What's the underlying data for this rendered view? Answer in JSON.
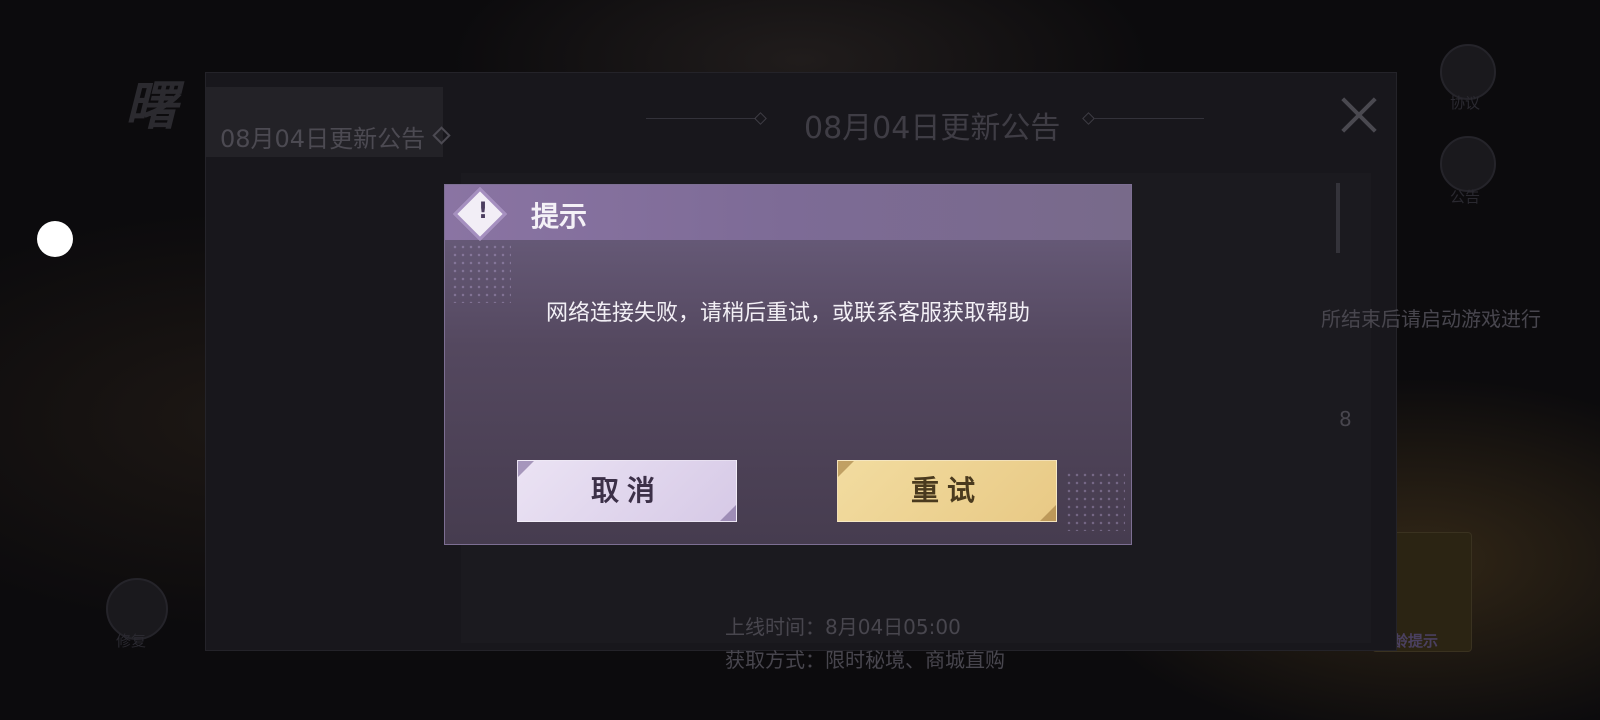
{
  "background": {
    "logo_text": "曙",
    "side_labels": {
      "agreement": "协议",
      "notice": "公告",
      "repair": "修复",
      "age": "适龄提示"
    }
  },
  "panel": {
    "tab_label": "08月04日更新公告",
    "title": "08月04日更新公告",
    "content_lines": {
      "line1": "所结束后请启动游戏进行",
      "line2": "8",
      "line3": "上线时间：8月04日05:00",
      "line4": "获取方式：限时秘境、商城直购"
    }
  },
  "dialog": {
    "title": "提示",
    "emblem_glyph": "!",
    "message": "网络连接失败，请稍后重试，或联系客服获取帮助",
    "cancel_label": "取消",
    "retry_label": "重试"
  },
  "colors": {
    "dialog_header": "#8a74a3",
    "cancel_button": "#ebe3f4",
    "retry_button": "#f2dca0"
  }
}
